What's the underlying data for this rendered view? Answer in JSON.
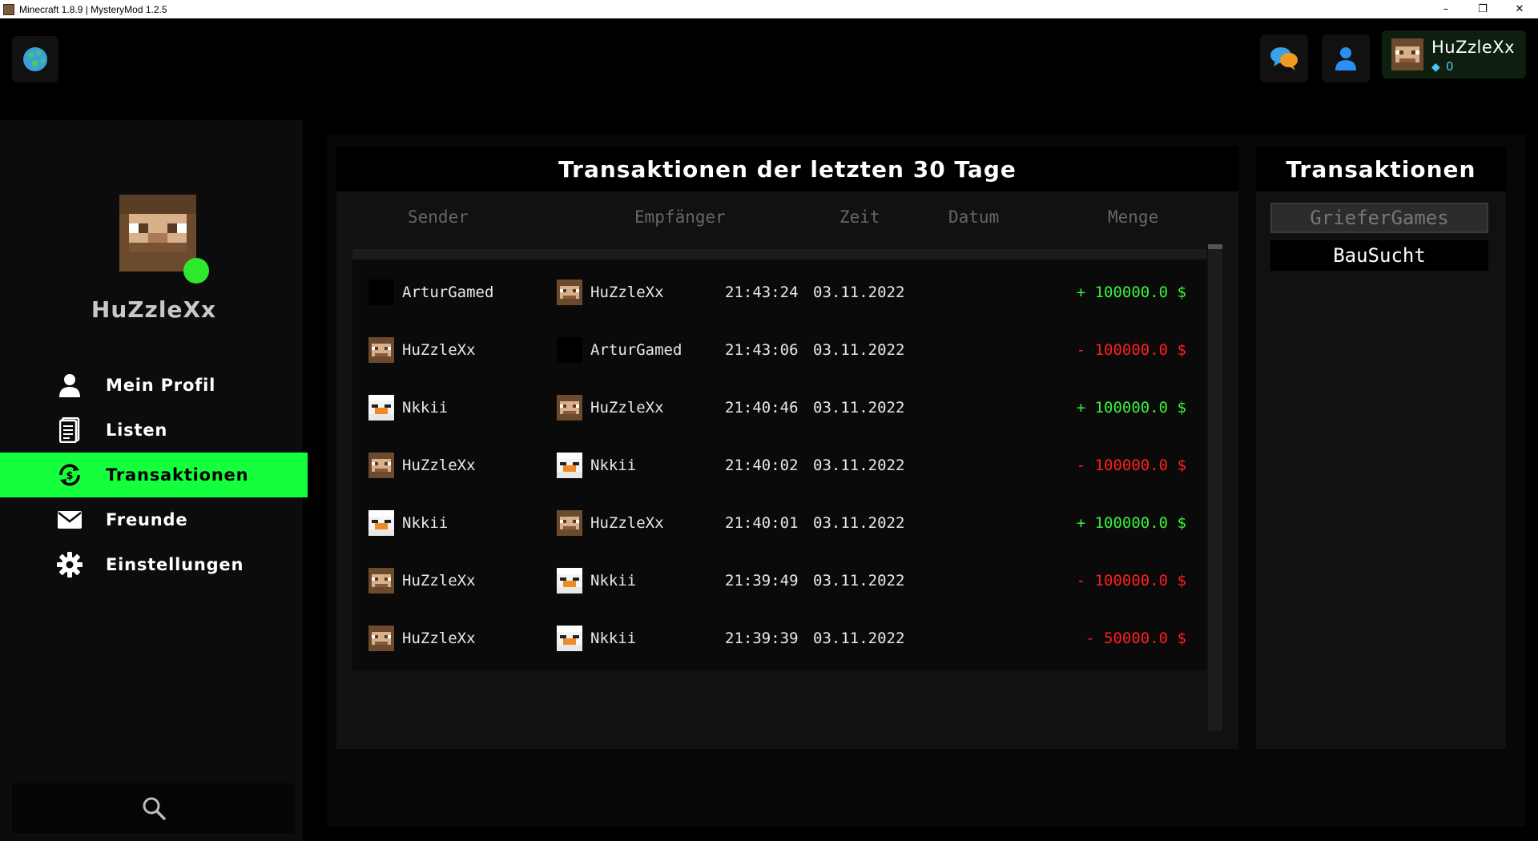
{
  "window": {
    "title": "Minecraft 1.8.9 | MysteryMod 1.2.5",
    "minimize": "–",
    "maximize": "❐",
    "close": "✕"
  },
  "account": {
    "name": "HuZzleXx",
    "gems": "0"
  },
  "profile": {
    "name": "HuZzleXx",
    "online_color": "#2ee82e"
  },
  "nav": [
    {
      "label": "Mein Profil",
      "icon": "user-icon"
    },
    {
      "label": "Listen",
      "icon": "list-icon"
    },
    {
      "label": "Transaktionen",
      "icon": "transaction-icon",
      "active": true
    },
    {
      "label": "Freunde",
      "icon": "mail-icon"
    },
    {
      "label": "Einstellungen",
      "icon": "gear-icon"
    }
  ],
  "transactions": {
    "title": "Transaktionen der letzten 30 Tage",
    "columns": {
      "sender": "Sender",
      "receiver": "Empfänger",
      "time": "Zeit",
      "date": "Datum",
      "amount": "Menge"
    },
    "rows": [
      {
        "sender": "ArturGamed",
        "receiver": "HuZzleXx",
        "time": "21:43:24",
        "date": "03.11.2022",
        "amount": "+ 100000.0 $",
        "positive": true
      },
      {
        "sender": "HuZzleXx",
        "receiver": "ArturGamed",
        "time": "21:43:06",
        "date": "03.11.2022",
        "amount": "- 100000.0 $",
        "positive": false
      },
      {
        "sender": "Nkkii",
        "receiver": "HuZzleXx",
        "time": "21:40:46",
        "date": "03.11.2022",
        "amount": "+ 100000.0 $",
        "positive": true
      },
      {
        "sender": "HuZzleXx",
        "receiver": "Nkkii",
        "time": "21:40:02",
        "date": "03.11.2022",
        "amount": "- 100000.0 $",
        "positive": false
      },
      {
        "sender": "Nkkii",
        "receiver": "HuZzleXx",
        "time": "21:40:01",
        "date": "03.11.2022",
        "amount": "+ 100000.0 $",
        "positive": true
      },
      {
        "sender": "HuZzleXx",
        "receiver": "Nkkii",
        "time": "21:39:49",
        "date": "03.11.2022",
        "amount": "- 100000.0 $",
        "positive": false
      },
      {
        "sender": "HuZzleXx",
        "receiver": "Nkkii",
        "time": "21:39:39",
        "date": "03.11.2022",
        "amount": "- 50000.0 $",
        "positive": false
      }
    ]
  },
  "servers": {
    "title": "Transaktionen",
    "items": [
      "GrieferGames",
      "BauSucht"
    ]
  },
  "colors": {
    "accent": "#14ff3c",
    "positive": "#3cf03c",
    "negative": "#ff1e1e"
  }
}
